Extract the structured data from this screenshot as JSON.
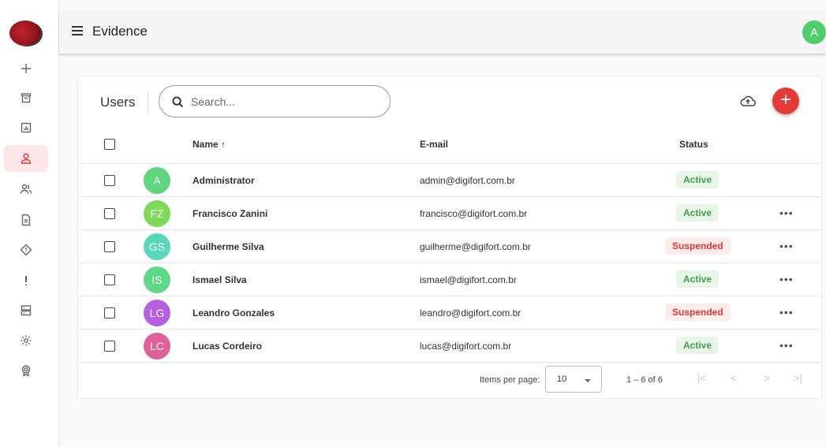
{
  "app": {
    "title": "Evidence",
    "user_initial": "A"
  },
  "sidebar": {
    "items": [
      {
        "name": "add",
        "icon": "plus-icon"
      },
      {
        "name": "archive",
        "icon": "archive-icon"
      },
      {
        "name": "reports",
        "icon": "chart-icon"
      },
      {
        "name": "users",
        "icon": "user-icon",
        "active": true
      },
      {
        "name": "groups",
        "icon": "users-icon"
      },
      {
        "name": "documents",
        "icon": "document-icon"
      },
      {
        "name": "alerts",
        "icon": "warning-icon"
      },
      {
        "name": "notices",
        "icon": "exclamation-icon"
      },
      {
        "name": "servers",
        "icon": "server-icon"
      },
      {
        "name": "settings",
        "icon": "gear-icon"
      },
      {
        "name": "licenses",
        "icon": "badge-icon"
      }
    ]
  },
  "card": {
    "title": "Users",
    "search_placeholder": "Search...",
    "columns": {
      "name": "Name ↑",
      "email": "E-mail",
      "status": "Status"
    },
    "rows": [
      {
        "initials": "A",
        "name": "Administrator",
        "email": "admin@digifort.com.br",
        "status": "Active",
        "more": "",
        "color": "#5fd57d"
      },
      {
        "initials": "FZ",
        "name": "Francisco Zanini",
        "email": "francisco@digifort.com.br",
        "status": "Active",
        "more": "•••",
        "color": "#7ed957"
      },
      {
        "initials": "GS",
        "name": "Guilherme Silva",
        "email": "guilherme@digifort.com.br",
        "status": "Suspended",
        "more": "•••",
        "color": "#57d8b8"
      },
      {
        "initials": "IS",
        "name": "Ismael Silva",
        "email": "ismael@digifort.com.br",
        "status": "Active",
        "more": "•••",
        "color": "#5fd887"
      },
      {
        "initials": "LG",
        "name": "Leandro Gonzales",
        "email": "leandro@digifort.com.br",
        "status": "Suspended",
        "more": "•••",
        "color": "#b65fe0"
      },
      {
        "initials": "LC",
        "name": "Lucas Cordeiro",
        "email": "lucas@digifort.com.br",
        "status": "Active",
        "more": "•••",
        "color": "#e0609a"
      }
    ]
  },
  "pager": {
    "items_per_page_label": "Items per page:",
    "items_per_page": "10",
    "range": "1 – 6 of 6",
    "first": "|<",
    "prev": "<",
    "next": ">",
    "last": ">|"
  },
  "colors": {
    "accent": "#e53935",
    "active_bg": "#e8f5e9",
    "active_text": "#43a047",
    "suspended_bg": "#fdecea",
    "suspended_text": "#e53935"
  }
}
